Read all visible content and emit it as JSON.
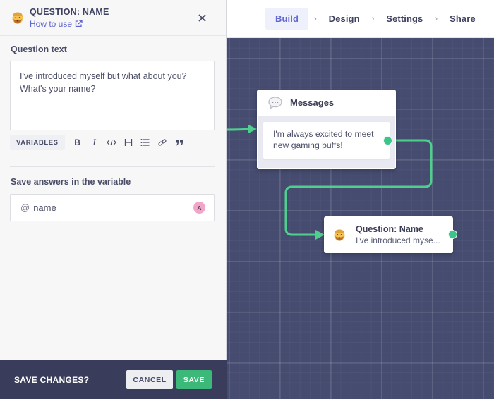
{
  "panel": {
    "header": {
      "icon": "person-bearded-emoji",
      "title": "QUESTION: NAME",
      "link_label": "How to use",
      "link_icon": "external-link-icon",
      "close_icon": "close-icon"
    },
    "question_text": {
      "label": "Question text",
      "value": "I've introduced myself but what about you?\nWhat's your name?"
    },
    "toolbar": {
      "variables_label": "VARIABLES",
      "buttons": [
        {
          "name": "bold",
          "glyph": "B"
        },
        {
          "name": "italic",
          "glyph": "I"
        },
        {
          "name": "code",
          "glyph": "</>"
        },
        {
          "name": "heading",
          "glyph": "H"
        },
        {
          "name": "list",
          "glyph": "☰"
        },
        {
          "name": "link",
          "glyph": "🔗"
        },
        {
          "name": "quote",
          "glyph": "❞"
        }
      ]
    },
    "save_variable": {
      "label": "Save answers in the variable",
      "prefix": "@",
      "value": "name",
      "badge": "A"
    },
    "footer": {
      "label": "SAVE CHANGES?",
      "cancel_label": "CANCEL",
      "save_label": "SAVE"
    }
  },
  "topnav": {
    "items": [
      {
        "label": "Build",
        "active": true
      },
      {
        "label": "Design",
        "active": false
      },
      {
        "label": "Settings",
        "active": false
      },
      {
        "label": "Share",
        "active": false
      }
    ],
    "separator": "›"
  },
  "canvas": {
    "nodes": [
      {
        "type": "messages",
        "title": "Messages",
        "icon": "speech-bubble-icon",
        "message": "I'm always excited to meet new gaming buffs!"
      },
      {
        "type": "question",
        "title": "Question: Name",
        "icon": "person-bearded-emoji",
        "preview": "I've introduced myse..."
      }
    ]
  },
  "colors": {
    "accent": "#6169d1",
    "connector": "#4fcf8d",
    "save_button": "#3cb879",
    "canvas_bg": "#464c70",
    "footer_bg": "#393c5a"
  }
}
